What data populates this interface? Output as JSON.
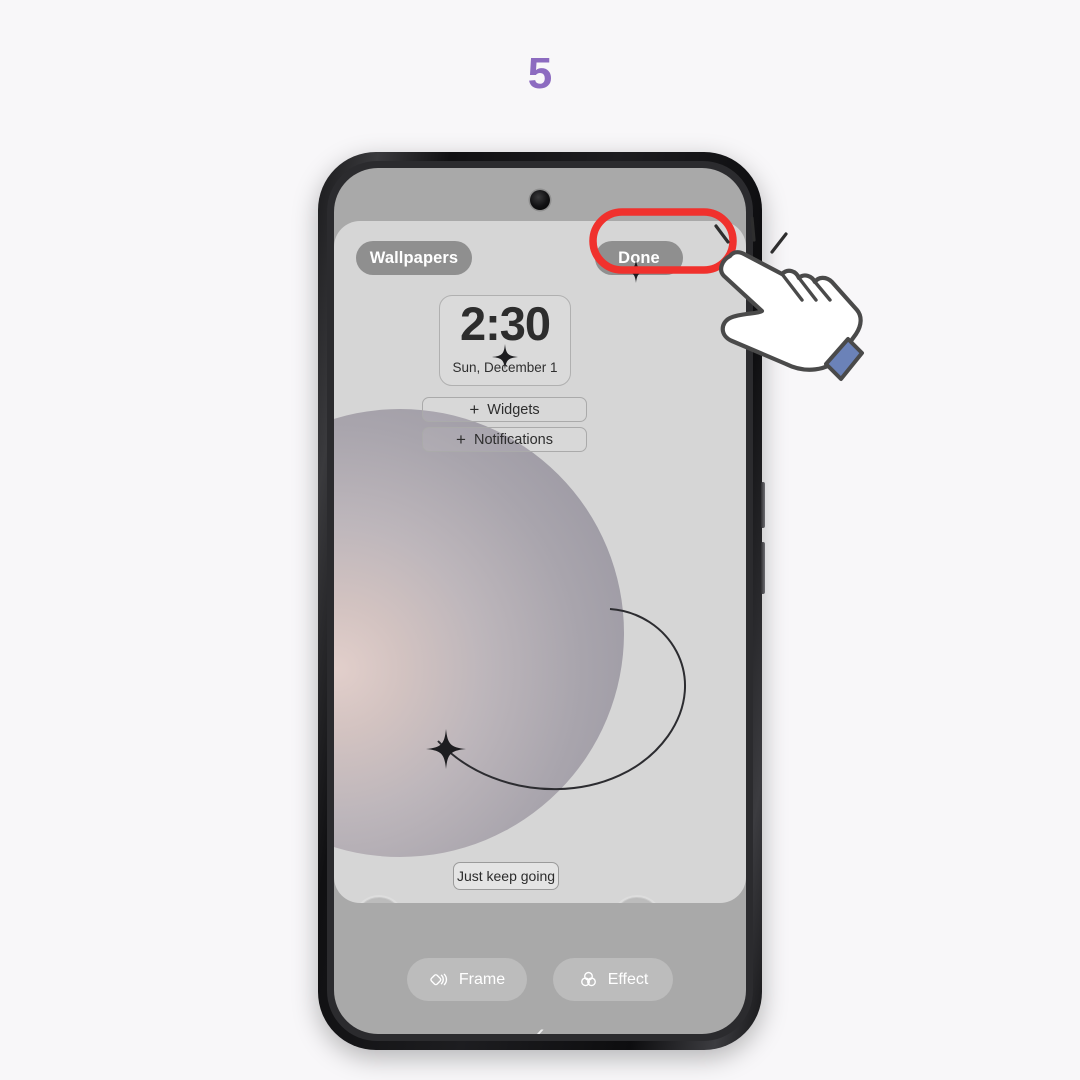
{
  "step": {
    "number": "5",
    "color": "#8c6bc0"
  },
  "phone": {
    "device_label": "smartphone-mockup",
    "frame_color": "#141416",
    "screen_background": "#a9a9a9"
  },
  "lock_screen": {
    "panel_background": "#d6d6d6",
    "top_bar": {
      "wallpapers_label": "Wallpapers",
      "done_label": "Done",
      "pill_color": "#8f8f8f",
      "pill_text_color": "#ffffff"
    },
    "clock_widget": {
      "time": "2:30",
      "date": "Sun, December 1"
    },
    "add_rows": [
      {
        "icon": "plus-icon",
        "label": "Widgets"
      },
      {
        "icon": "plus-icon",
        "label": "Notifications"
      }
    ],
    "keep_going_chip": {
      "label": "Just keep going"
    },
    "shortcuts": [
      {
        "icon": "flashlight-icon",
        "name": "flashlight-shortcut"
      },
      {
        "icon": "camera-icon",
        "name": "camera-shortcut"
      }
    ],
    "wallpaper": {
      "type": "sphere-with-orbit",
      "sphere_highlight": "#e2cfcb",
      "sphere_shade": "#96939d",
      "decorations": [
        "orbit-ring",
        "four-point-star"
      ]
    }
  },
  "editor_toolbar": {
    "items": [
      {
        "icon": "frame-icon",
        "label": "Frame"
      },
      {
        "icon": "effect-icon",
        "label": "Effect"
      }
    ]
  },
  "navigation": {
    "back_chevron": "‹"
  },
  "annotation": {
    "highlight_target": "Done",
    "highlight_color": "#f0312d",
    "cursor": "pointing-hand-cursor",
    "cursor_cuff_color": "#6b82b8"
  }
}
